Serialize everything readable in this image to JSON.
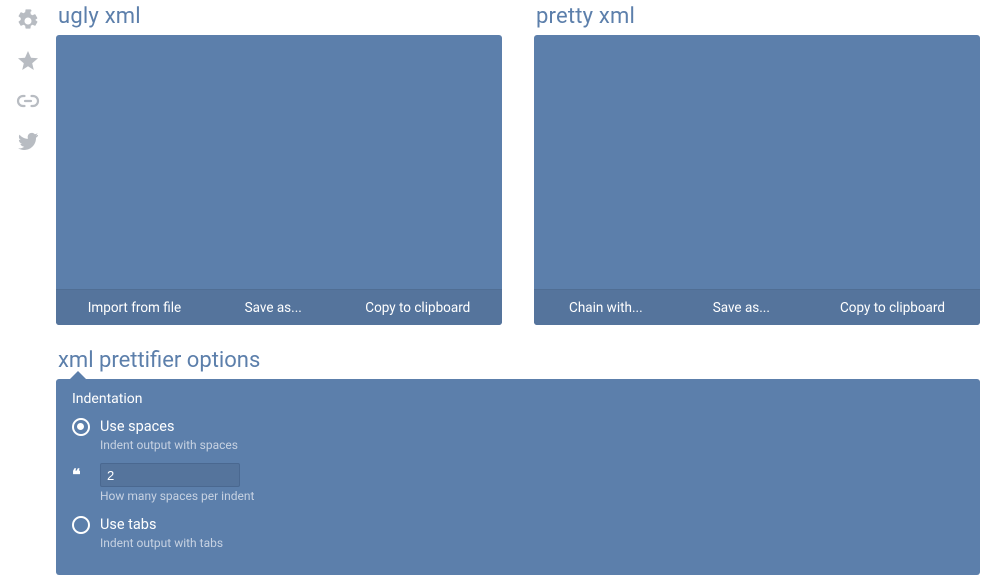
{
  "side_tools": {
    "settings": "settings",
    "favorite": "favorite",
    "link": "link",
    "twitter": "twitter"
  },
  "left_panel": {
    "title": "ugly xml",
    "actions": {
      "import": "Import from file",
      "save": "Save as...",
      "copy": "Copy to clipboard"
    }
  },
  "right_panel": {
    "title": "pretty xml",
    "actions": {
      "chain": "Chain with...",
      "save": "Save as...",
      "copy": "Copy to clipboard"
    }
  },
  "options": {
    "title": "xml prettifier options",
    "heading": "Indentation",
    "use_spaces": {
      "label": "Use spaces",
      "desc": "Indent output with spaces",
      "selected": true
    },
    "indent_value": "2",
    "indent_desc": "How many spaces per indent",
    "use_tabs": {
      "label": "Use tabs",
      "desc": "Indent output with tabs",
      "selected": false
    }
  },
  "colors": {
    "panel_bg": "#5c7fab",
    "panel_bar": "#55749c",
    "title_text": "#5c7fab",
    "icon_grey": "#b8bcc2"
  }
}
